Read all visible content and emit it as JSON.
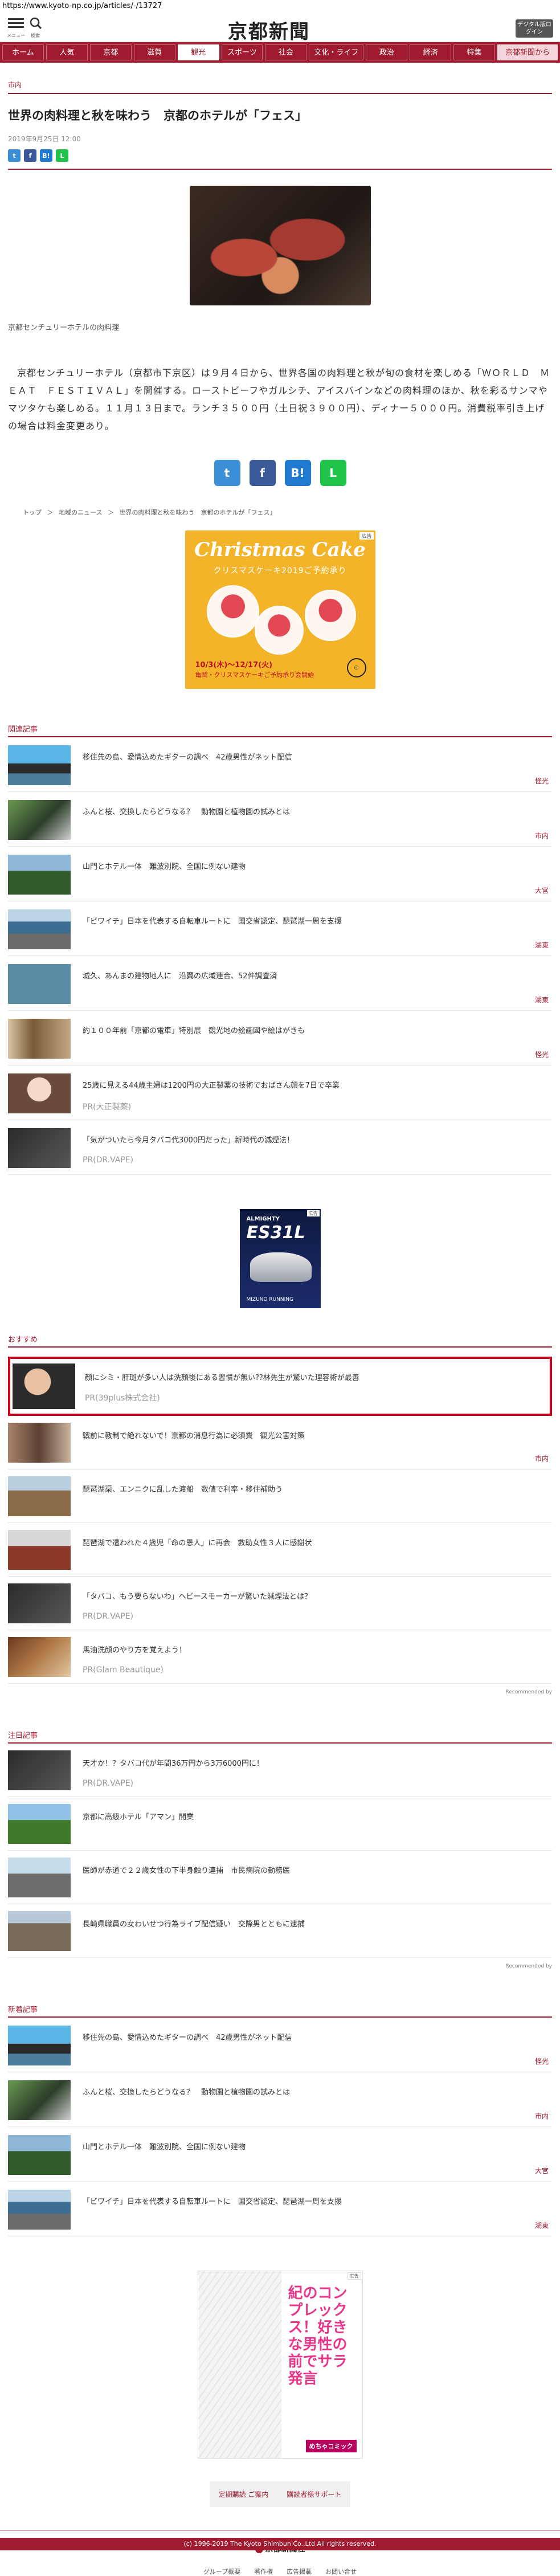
{
  "url": "https://www.kyoto-np.co.jp/articles/-/13727",
  "header": {
    "menu_label": "メニュー",
    "search_label": "検索",
    "logo": "京都新聞",
    "digital_button": "デジタル版ログイン"
  },
  "nav": [
    "ホーム",
    "人気",
    "京都",
    "滋賀",
    "観光",
    "スポーツ",
    "社会",
    "文化・ライフ",
    "政治",
    "経済",
    "特集",
    "京都新聞から"
  ],
  "article": {
    "category": "市内",
    "headline": "世界の肉料理と秋を味わう　京都のホテルが「フェス」",
    "date": "2019年9月25日 12:00",
    "caption": "京都センチュリーホテルの肉料理",
    "body": "京都センチュリーホテル（京都市下京区）は９月４日から、世界各国の肉料理と秋が旬の食材を楽しめる「ＷＯＲＬＤ　ＭＥＡＴ　ＦＥＳＴＩＶＡＬ」を開催する。ローストビーフやガルシチ、アイスバインなどの肉料理のほか、秋を彩るサンマやマツタケも楽しめる。１１月１３日まで。ランチ３５００円（土日祝３９００円）、ディナー５０００円。消費税率引き上げの場合は料金変更あり。"
  },
  "share": {
    "twitter": "t",
    "facebook": "f",
    "hatena": "B!",
    "line": "L"
  },
  "breadcrumb": [
    "トップ",
    "＞",
    "地域のニュース",
    "＞",
    "世界の肉料理と秋を味わう　京都のホテルが「フェス」"
  ],
  "xmas_ad": {
    "title": "Christmas Cake",
    "subtitle": "クリスマスケーキ2019ご予約承り",
    "dates": "10/3(木)～12/17(火)",
    "note": "亀岡・クリスマスケーキご予約承り会開始",
    "ad_label": "広告"
  },
  "related": {
    "title": "関連記事",
    "items": [
      {
        "title": "移住先の島、愛情込めたギターの調べ　42歳男性がネット配信",
        "cat": "怪光"
      },
      {
        "title": "ふんと桜、交換したらどうなる？　動物園と植物園の試みとは",
        "cat": "市内"
      },
      {
        "title": "山門とホテル一体　難波別院、全国に例ない建物",
        "cat": "大宮"
      },
      {
        "title": "「ビワイチ」日本を代表する自転車ルートに　国交省認定、琵琶湖一周を支援",
        "cat": "湖東"
      },
      {
        "title": "城久、あんまの建物地人に　沿翼の広域連合、52件調査済",
        "cat": "湖東"
      },
      {
        "title": "約１００年前「京都の電車」特別展　観光地の絵画図や絵はがきも",
        "cat": "怪光"
      },
      {
        "title": "25歳に見える44歳主婦は1200円の大正製薬の技術でおばさん顔を7日で卒業",
        "pr": "PR(大正製薬)"
      },
      {
        "title": "「気がついたら今月タバコ代3000円だった」新時代の減煙法！",
        "pr": "PR(DR.VAPE)"
      }
    ]
  },
  "mizuno_ad": {
    "brand": "ALMIGHTY",
    "model": "ES31L",
    "footer": "MIZUNO RUNNING",
    "ad_label": "広告"
  },
  "recommend": {
    "title": "おすすめ",
    "highlight": {
      "title": "顔にシミ・肝斑が多い人は洗顔後にある習慣が無い??林先生が驚いた理容術が最善",
      "pr": "PR(39plus株式会社)"
    },
    "items": [
      {
        "title": "戦前に教制で絶れないで！京都の消息行為に必須費　観光公害対策",
        "cat": "市内"
      },
      {
        "title": "琵琶湖渠、エンニクに乱した渡船　数値で利率・移住補助う",
        "cat": ""
      },
      {
        "title": "琵琶湖で遭われた４歳児「命の恩人」に再会　救助女性３人に感謝状",
        "cat": ""
      },
      {
        "title": "「タバコ、もう要らないわ」ヘビースモーカーが驚いた減煙法とは？",
        "pr": "PR(DR.VAPE)"
      },
      {
        "title": "馬油洗顔のやり方を覚えよう！",
        "pr": "PR(Glam Beautique)"
      }
    ],
    "powered": "Recommended by"
  },
  "featured": {
    "title": "注目記事",
    "items": [
      {
        "title": "天才か！？タバコ代が年間36万円から3万6000円に！",
        "pr": "PR(DR.VAPE)"
      },
      {
        "title": "京都に高級ホテル「アマン」開業",
        "cat": ""
      },
      {
        "title": "医師が赤道で２２歳女性の下半身触り連捕　市民病院の勤務医",
        "cat": ""
      },
      {
        "title": "長崎県職員の女わいせつ行為ライブ配信疑い　交際男とともに逮捕",
        "cat": ""
      }
    ],
    "powered": "Recommended by"
  },
  "newest": {
    "title": "新着記事",
    "items": [
      {
        "title": "移住先の島、愛情込めたギターの調べ　42歳男性がネット配信",
        "cat": "怪光"
      },
      {
        "title": "ふんと桜、交換したらどうなる？　動物園と植物園の試みとは",
        "cat": "市内"
      },
      {
        "title": "山門とホテル一体　難波別院、全国に例ない建物",
        "cat": "大宮"
      },
      {
        "title": "「ビワイチ」日本を代表する自転車ルートに　国交省認定、琵琶湖一周を支援",
        "cat": "湖東"
      }
    ]
  },
  "manga_ad": {
    "title": "紀のコンプレックス！好きな男性の前でサラ発言",
    "sub": "めちゃコミック",
    "logo": "めちゃコミック",
    "ad_label": "広告"
  },
  "bottom_buttons": [
    "定期購読 ご案内",
    "購読者様サポート"
  ],
  "footer": {
    "logo": "京都新聞社",
    "links": [
      "グループ概要",
      "著作権",
      "広告掲載",
      "お問い合せ"
    ],
    "copyright": "(c) 1996-2019 The Kyoto Shimbun Co.,Ltd All rights reserved."
  }
}
